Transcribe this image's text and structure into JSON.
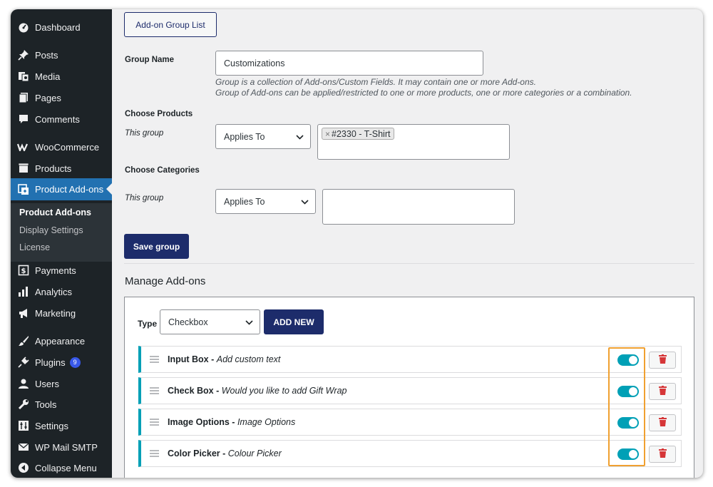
{
  "sidebar": {
    "items": [
      {
        "label": "Dashboard",
        "icon": "dashboard-icon"
      },
      {
        "label": "Posts",
        "icon": "pin-icon"
      },
      {
        "label": "Media",
        "icon": "media-icon"
      },
      {
        "label": "Pages",
        "icon": "pages-icon"
      },
      {
        "label": "Comments",
        "icon": "comment-icon"
      },
      {
        "label": "WooCommerce",
        "icon": "woocommerce-icon"
      },
      {
        "label": "Products",
        "icon": "products-icon"
      },
      {
        "label": "Product Add-ons",
        "icon": "addons-icon"
      },
      {
        "label": "Payments",
        "icon": "payments-icon"
      },
      {
        "label": "Analytics",
        "icon": "analytics-icon"
      },
      {
        "label": "Marketing",
        "icon": "megaphone-icon"
      },
      {
        "label": "Appearance",
        "icon": "brush-icon"
      },
      {
        "label": "Plugins",
        "icon": "plugin-icon"
      },
      {
        "label": "Users",
        "icon": "users-icon"
      },
      {
        "label": "Tools",
        "icon": "wrench-icon"
      },
      {
        "label": "Settings",
        "icon": "settings-icon"
      },
      {
        "label": "WP Mail SMTP",
        "icon": "mail-icon"
      },
      {
        "label": "Collapse Menu",
        "icon": "collapse-icon"
      }
    ],
    "plugins_count": "9",
    "submenu": [
      "Product Add-ons",
      "Display Settings",
      "License"
    ]
  },
  "header": {
    "group_list_button": "Add-on Group List"
  },
  "form": {
    "group_name_label": "Group Name",
    "group_name_value": "Customizations",
    "group_desc_1": "Group is a collection of Add-ons/Custom Fields. It may contain one or more Add-ons.",
    "group_desc_2": "Group of Add-ons can be applied/restricted to one or more products, one or more categories or a combination.",
    "choose_products_label": "Choose Products",
    "this_group_label": "This group",
    "products_select": "Applies To",
    "product_tag": "#2330 - T-Shirt",
    "tag_remove": "×",
    "choose_categories_label": "Choose Categories",
    "categories_select": "Applies To",
    "save_button": "Save group"
  },
  "manage": {
    "heading": "Manage Add-ons",
    "type_label": "Type",
    "type_value": "Checkbox",
    "add_new_button": "ADD NEW",
    "addons": [
      {
        "name": "Input Box",
        "desc": "Add custom text"
      },
      {
        "name": "Check Box",
        "desc": "Would you like to add Gift Wrap"
      },
      {
        "name": "Image Options",
        "desc": "Image Options"
      },
      {
        "name": "Color Picker",
        "desc": "Colour Picker"
      }
    ],
    "separator": " - "
  },
  "colors": {
    "accent": "#00a0b6",
    "primary": "#1d2c6b",
    "highlight": "#f0a030",
    "sidebar": "#1d2327",
    "delete": "#d63638"
  }
}
